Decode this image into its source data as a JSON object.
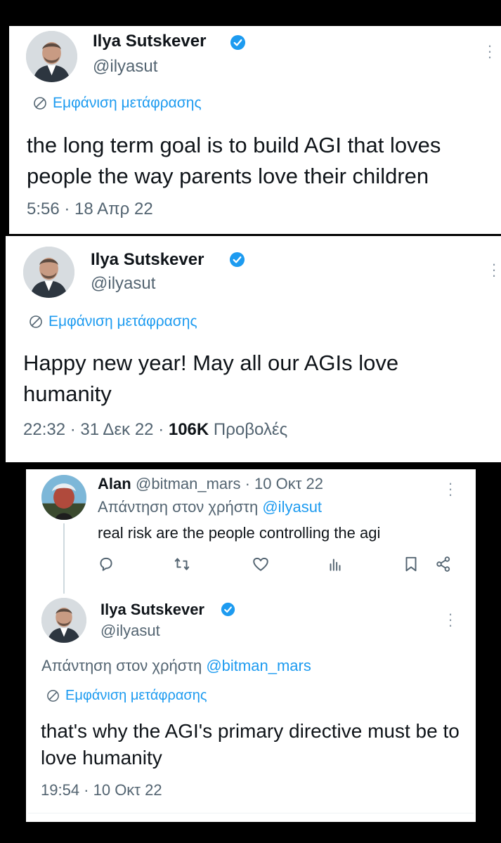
{
  "tweets": [
    {
      "name": "Ilya Sutskever",
      "handle": "@ilyasut",
      "translate": "Εμφάνιση μετάφρασης",
      "text": "the long term goal is to build AGI that loves people the way parents love their children",
      "time": "5:56 · 18 Απρ 22"
    },
    {
      "name": "Ilya Sutskever",
      "handle": "@ilyasut",
      "translate": "Εμφάνιση μετάφρασης",
      "text": "Happy new year! May all our AGIs love humanity",
      "time": "22:32 · 31 Δεκ 22 · ",
      "views_count": "106K",
      "views_label": " Προβολές"
    }
  ],
  "reply_thread": {
    "parent": {
      "name": "Alan",
      "handle_date": " @bitman_mars · 10 Οκτ 22",
      "reply_to_prefix": "Απάντηση στον χρήστη ",
      "reply_to_handle": "@ilyasut",
      "text": "real risk are the people controlling the agi"
    },
    "reply": {
      "name": "Ilya Sutskever",
      "handle": "@ilyasut",
      "reply_to_prefix": "Απάντηση στον χρήστη ",
      "reply_to_handle": "@bitman_mars",
      "translate": "Εμφάνιση μετάφρασης",
      "text": "that's why the AGI's primary directive must be to love humanity",
      "time": "19:54 · 10 Οκτ 22"
    }
  },
  "icons": {
    "verified": "verified-badge-icon",
    "translate": "translate-globe-icon",
    "more": "more-options-icon",
    "actions": [
      "reply-icon",
      "retweet-icon",
      "like-icon",
      "views-icon",
      "bookmark-icon",
      "share-icon"
    ]
  },
  "colors": {
    "accent": "#1d9bf0",
    "secondary": "#536471",
    "text": "#0f1419"
  }
}
